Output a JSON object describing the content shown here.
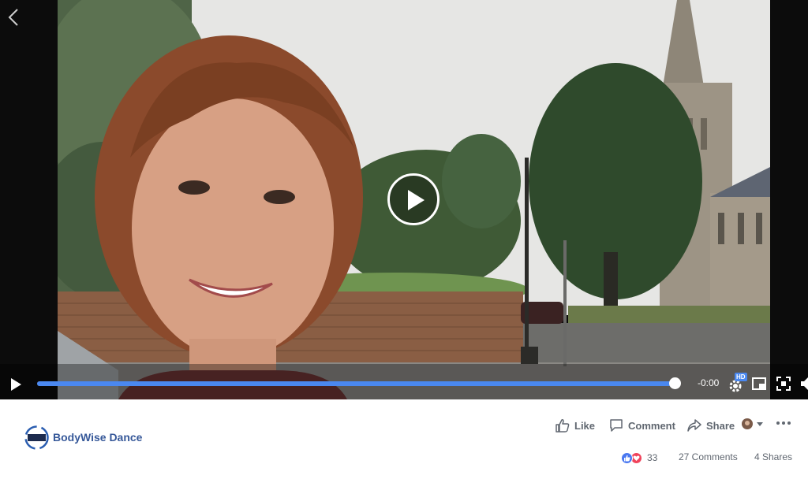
{
  "video": {
    "time_remaining": "-0:00",
    "quality_badge": "HD",
    "progress": 1.0
  },
  "post": {
    "page_name": "BodyWise Dance",
    "actions": {
      "like": "Like",
      "comment": "Comment",
      "share": "Share"
    },
    "stats": {
      "reaction_count": "33",
      "comments": "27 Comments",
      "shares": "4 Shares"
    }
  },
  "colors": {
    "accent_blue": "#4a88f0",
    "link_blue": "#365899",
    "muted_text": "#606770",
    "love_red": "#f0435b"
  },
  "icons": [
    "back-chevron-icon",
    "play-icon",
    "gear-icon",
    "pip-icon",
    "fullscreen-icon",
    "volume-icon",
    "thumbs-up-icon",
    "comment-bubble-icon",
    "share-arrow-icon",
    "ellipsis-icon"
  ]
}
